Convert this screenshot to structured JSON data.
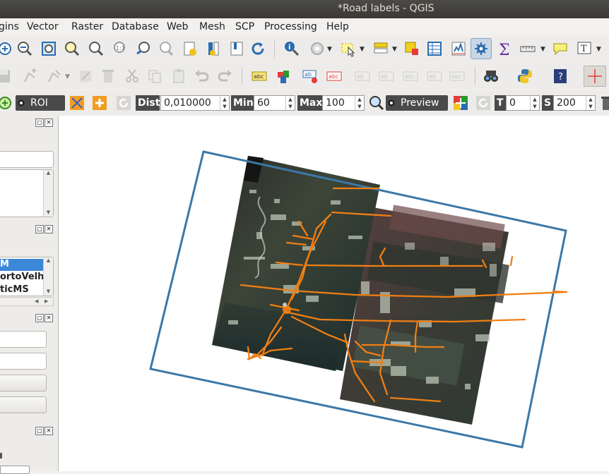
{
  "window": {
    "title": "*Road labels - QGIS"
  },
  "menu": [
    "gins",
    "Vector",
    "Raster",
    "Database",
    "Web",
    "Mesh",
    "SCP",
    "Processing",
    "Help"
  ],
  "scp_toolbar": {
    "roi_label": "ROI",
    "dist_label": "Dist",
    "dist_value": "0,010000",
    "min_label": "Min",
    "min_value": "60",
    "max_label": "Max",
    "max_value": "100",
    "preview_label": "Preview",
    "t_label": "T",
    "t_value": "0",
    "s_label": "S",
    "s_value": "200"
  },
  "panels": {
    "layers_list": [
      "M",
      "ortoVelh",
      "ticMS"
    ]
  },
  "colors": {
    "road": "#f07f14",
    "extent": "#3b78a8",
    "selection": "#3b87d8"
  },
  "icons": [
    "zoom-in-icon",
    "zoom-out-icon",
    "zoom-full-icon",
    "zoom-layer-icon",
    "zoom-selection-icon",
    "zoom-native-icon",
    "zoom-last-icon",
    "zoom-next-icon",
    "new-bookmark-icon",
    "show-bookmarks-icon",
    "refresh-icon",
    "identify-icon",
    "run-action-icon",
    "select-features-icon",
    "select-by-value-icon",
    "deselect-icon",
    "attribute-table-icon",
    "field-calculator-icon",
    "toolbox-icon",
    "statistics-icon",
    "measure-icon",
    "annotation-icon",
    "text-annotation-icon"
  ]
}
